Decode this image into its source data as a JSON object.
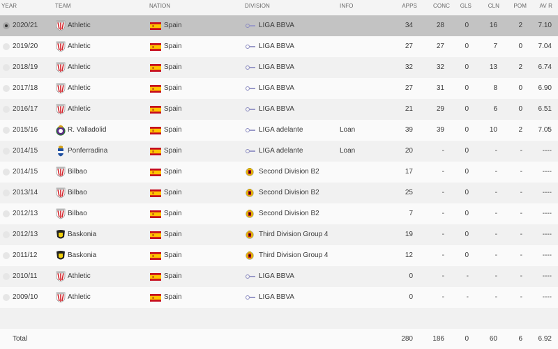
{
  "columns": {
    "year": "YEAR",
    "team": "TEAM",
    "nation": "NATION",
    "division": "DIVISION",
    "info": "INFO",
    "apps": "APPS",
    "conc": "CONC",
    "gls": "GLS",
    "cln": "CLN",
    "pom": "POM",
    "avr": "AV R"
  },
  "rows": [
    {
      "year": "2020/21",
      "team": "Athletic",
      "crest": "athletic",
      "nation": "Spain",
      "division": "LIGA BBVA",
      "div_icon": "liga",
      "info": "",
      "apps": "34",
      "conc": "28",
      "gls": "0",
      "cln": "16",
      "pom": "2",
      "avr": "7.10",
      "selected": true
    },
    {
      "year": "2019/20",
      "team": "Athletic",
      "crest": "athletic",
      "nation": "Spain",
      "division": "LIGA BBVA",
      "div_icon": "liga",
      "info": "",
      "apps": "27",
      "conc": "27",
      "gls": "0",
      "cln": "7",
      "pom": "0",
      "avr": "7.04"
    },
    {
      "year": "2018/19",
      "team": "Athletic",
      "crest": "athletic",
      "nation": "Spain",
      "division": "LIGA BBVA",
      "div_icon": "liga",
      "info": "",
      "apps": "32",
      "conc": "32",
      "gls": "0",
      "cln": "13",
      "pom": "2",
      "avr": "6.74"
    },
    {
      "year": "2017/18",
      "team": "Athletic",
      "crest": "athletic",
      "nation": "Spain",
      "division": "LIGA BBVA",
      "div_icon": "liga",
      "info": "",
      "apps": "27",
      "conc": "31",
      "gls": "0",
      "cln": "8",
      "pom": "0",
      "avr": "6.90"
    },
    {
      "year": "2016/17",
      "team": "Athletic",
      "crest": "athletic",
      "nation": "Spain",
      "division": "LIGA BBVA",
      "div_icon": "liga",
      "info": "",
      "apps": "21",
      "conc": "29",
      "gls": "0",
      "cln": "6",
      "pom": "0",
      "avr": "6.51"
    },
    {
      "year": "2015/16",
      "team": "R. Valladolid",
      "crest": "valladolid",
      "nation": "Spain",
      "division": "LIGA adelante",
      "div_icon": "liga",
      "info": "Loan",
      "apps": "39",
      "conc": "39",
      "gls": "0",
      "cln": "10",
      "pom": "2",
      "avr": "7.05"
    },
    {
      "year": "2014/15",
      "team": "Ponferradina",
      "crest": "ponferradina",
      "nation": "Spain",
      "division": "LIGA adelante",
      "div_icon": "liga",
      "info": "Loan",
      "apps": "20",
      "conc": "-",
      "gls": "0",
      "cln": "-",
      "pom": "-",
      "avr": "----"
    },
    {
      "year": "2014/15",
      "team": "Bilbao",
      "crest": "athletic",
      "nation": "Spain",
      "division": "Second Division B2",
      "div_icon": "rfef",
      "info": "",
      "apps": "17",
      "conc": "-",
      "gls": "0",
      "cln": "-",
      "pom": "-",
      "avr": "----"
    },
    {
      "year": "2013/14",
      "team": "Bilbao",
      "crest": "athletic",
      "nation": "Spain",
      "division": "Second Division B2",
      "div_icon": "rfef",
      "info": "",
      "apps": "25",
      "conc": "-",
      "gls": "0",
      "cln": "-",
      "pom": "-",
      "avr": "----"
    },
    {
      "year": "2012/13",
      "team": "Bilbao",
      "crest": "athletic",
      "nation": "Spain",
      "division": "Second Division B2",
      "div_icon": "rfef",
      "info": "",
      "apps": "7",
      "conc": "-",
      "gls": "0",
      "cln": "-",
      "pom": "-",
      "avr": "----"
    },
    {
      "year": "2012/13",
      "team": "Baskonia",
      "crest": "baskonia",
      "nation": "Spain",
      "division": "Third Division Group 4",
      "div_icon": "rfef",
      "info": "",
      "apps": "19",
      "conc": "-",
      "gls": "0",
      "cln": "-",
      "pom": "-",
      "avr": "----"
    },
    {
      "year": "2011/12",
      "team": "Baskonia",
      "crest": "baskonia",
      "nation": "Spain",
      "division": "Third Division Group 4",
      "div_icon": "rfef",
      "info": "",
      "apps": "12",
      "conc": "-",
      "gls": "0",
      "cln": "-",
      "pom": "-",
      "avr": "----"
    },
    {
      "year": "2010/11",
      "team": "Athletic",
      "crest": "athletic",
      "nation": "Spain",
      "division": "LIGA BBVA",
      "div_icon": "liga",
      "info": "",
      "apps": "0",
      "conc": "-",
      "gls": "-",
      "cln": "-",
      "pom": "-",
      "avr": "----"
    },
    {
      "year": "2009/10",
      "team": "Athletic",
      "crest": "athletic",
      "nation": "Spain",
      "division": "LIGA BBVA",
      "div_icon": "liga",
      "info": "",
      "apps": "0",
      "conc": "-",
      "gls": "-",
      "cln": "-",
      "pom": "-",
      "avr": "----"
    }
  ],
  "total": {
    "label": "Total",
    "apps": "280",
    "conc": "186",
    "gls": "0",
    "cln": "60",
    "pom": "6",
    "avr": "6.92"
  },
  "colors": {
    "selected_row": "#c3c3c3",
    "row_odd": "#fafafa",
    "row_even": "#f1f1f1",
    "spain_red": "#c60b1e",
    "spain_yellow": "#ffc400"
  }
}
